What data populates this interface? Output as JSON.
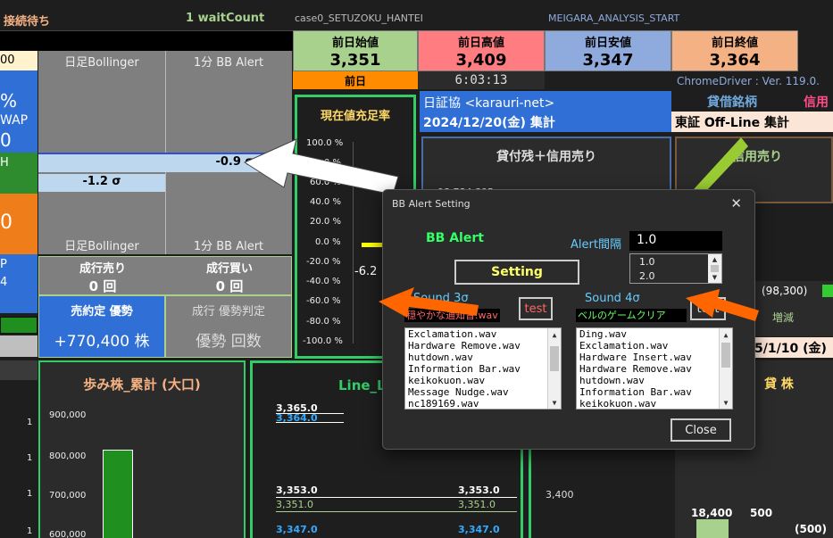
{
  "topbar": {
    "status": "接続待ち",
    "wait_count": "1 waitCount",
    "case_label": "case0_SETUZOKU_HANTEI",
    "meigara_label": "MEIGARA_ANALYSIS_START"
  },
  "prev_day": {
    "open_label": "前日始値",
    "open_value": "3,351",
    "high_label": "前日高値",
    "high_value": "3,409",
    "low_label": "前日安値",
    "low_value": "3,347",
    "close_label": "前日終値",
    "close_value": "3,364",
    "prev_label": "前日",
    "time": "6:03:13",
    "chromedriver": "ChromeDriver : Ver. 119.0."
  },
  "left_strip": {
    "top_value": "00",
    "pct": "%",
    "wap": "WAP",
    "zero": "0",
    "h": "H",
    "big_zero": "0",
    "p": "P",
    "four": "4"
  },
  "bollinger": {
    "daily_label_top": "日足Bollinger",
    "minute_label_top": "1分 BB Alert",
    "daily_label_bottom": "日足Bollinger",
    "minute_label_bottom": "1分 BB Alert",
    "sigma_minus09": "-0.9 σ",
    "sigma_minus12": "-1.2 σ"
  },
  "order_flow": {
    "sell_label": "成行売り",
    "sell_value": "0 回",
    "buy_label": "成行買い",
    "buy_value": "0 回",
    "contract_label": "売約定 優勢",
    "contract_value": "+770,400 株",
    "judge_label": "成行 優勢判定",
    "judge_value": "優勢 回数"
  },
  "fill_rate": {
    "title": "現在値充足率",
    "ticks": [
      "100.0 %",
      "80.0 %",
      "60.0 %",
      "40.0 %",
      "20.0 %",
      "0.0 %",
      "-20.0 %",
      "-40.0 %",
      "-60.0 %",
      "-80.0 %",
      "-100.0 %"
    ],
    "value_label": "-6.2"
  },
  "nissho": {
    "title": "日証協 <karauri-net>",
    "date": "2024/12/20(金) 集計",
    "zan_title": "貸付残＋信用売り",
    "peek_value": "98,784,895"
  },
  "right_panel": {
    "taishaku": "貸借銘柄",
    "shinyou": "信用",
    "tosho": "東証 Off-Line 集計",
    "shinyou_uri": "信用売り",
    "value_98300": "(98,300)",
    "zougen": "増減",
    "date_partial": "5/1/10 (金)",
    "kashikabu": "貸 株",
    "v18400": "18,400",
    "v500": "500",
    "v500p": "(500)",
    "v3400": "3,400"
  },
  "bottom_left": {
    "title": "歩み株_累計 (大口)",
    "ticks": [
      "900,000",
      "800,000",
      "700,000",
      "600,000"
    ],
    "side_ticks": [
      "1",
      "1",
      "1",
      "1"
    ]
  },
  "line_panel": {
    "title": "Line_L",
    "values_left": [
      "3,365.0",
      "3,364.0",
      "3,353.0",
      "3,351.0",
      "3,347.0"
    ],
    "values_right": [
      "3,353.0",
      "3,351.0",
      "3,347.0"
    ]
  },
  "dialog": {
    "title": "BB Alert Setting",
    "close_x": "✕",
    "header": "BB Alert",
    "interval_label": "Alert間隔",
    "interval_value": "1.0",
    "interval_options": [
      "1.0",
      "2.0"
    ],
    "setting_button": "Setting",
    "sound3_label": "Sound 3σ",
    "sound3_selected": "穏やかな通知音.wav",
    "test_button": "test",
    "sound4_label": "Sound 4σ",
    "sound4_selected": "ベルのゲームクリア",
    "test2_button": "test",
    "list3": [
      "Exclamation.wav",
      "Hardware Remove.wav",
      "hutdown.wav",
      "Information Bar.wav",
      "keikokuon.wav",
      "Message Nudge.wav",
      "nc189169.wav"
    ],
    "list4": [
      "Ding.wav",
      "Exclamation.wav",
      "Hardware Insert.wav",
      "Hardware Remove.wav",
      "hutdown.wav",
      "Information Bar.wav",
      "keikokuon.wav"
    ],
    "close_button": "Close"
  },
  "colors": {
    "open_bg": "#a9d18e",
    "high_bg": "#ff7c80",
    "low_bg": "#8faadc",
    "close_bg": "#f4b183",
    "green_frame": "#33cc66",
    "arrow_orange": "#ff6600",
    "arrow_green": "#99cc33"
  }
}
